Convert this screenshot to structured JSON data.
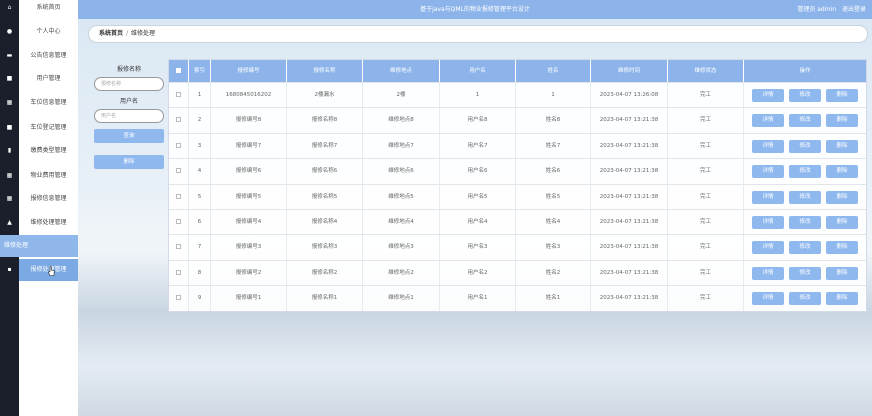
{
  "header": {
    "title": "基于java与QML的物业报修管理平台设计",
    "user_label": "管理员 admin",
    "logout_label": "退出登录"
  },
  "sidebar": {
    "items": [
      {
        "label": "系统首页",
        "icon": "home-icon"
      },
      {
        "label": "个人中心",
        "icon": "person-icon"
      },
      {
        "label": "公告信息管理",
        "icon": "contact-card-icon"
      },
      {
        "label": "用户管理",
        "icon": "monitor-icon"
      },
      {
        "label": "车位信息管理",
        "icon": "grid-icon"
      },
      {
        "label": "车位登记管理",
        "icon": "monitor-icon"
      },
      {
        "label": "缴费类型管理",
        "icon": "clipboard-icon"
      },
      {
        "label": "物业费用管理",
        "icon": "grid-icon"
      },
      {
        "label": "报修信息管理",
        "icon": "grid-icon"
      },
      {
        "label": "维修处理管理",
        "icon": "building-icon"
      }
    ],
    "sub_items": [
      {
        "label": "维修处理"
      },
      {
        "label": "报修处理管理",
        "icon": "chat-icon"
      }
    ]
  },
  "breadcrumb": {
    "home": "系统首页",
    "separator": "/",
    "current": "维修处理"
  },
  "search": {
    "name_label": "报修名称",
    "name_placeholder": "报修名称",
    "user_label": "用户名",
    "user_placeholder": "用户名",
    "query_button": "查询",
    "delete_button": "删除"
  },
  "table": {
    "headers": [
      "索引",
      "报修编号",
      "报修名称",
      "维修地点",
      "用户名",
      "姓名",
      "维修时间",
      "维修状态",
      "操作"
    ],
    "action_labels": {
      "detail": "详情",
      "edit": "修改",
      "delete": "删除"
    },
    "rows": [
      {
        "index": "1",
        "code": "1680845016202",
        "name": "2楼漏水",
        "place": "2楼",
        "user": "1",
        "realname": "1",
        "time": "2023-04-07 13:26:08",
        "status": "完工"
      },
      {
        "index": "2",
        "code": "报修编号8",
        "name": "报修名称8",
        "place": "维修地点8",
        "user": "用户名8",
        "realname": "姓名8",
        "time": "2023-04-07 13:21:38",
        "status": "完工"
      },
      {
        "index": "3",
        "code": "报修编号7",
        "name": "报修名称7",
        "place": "维修地点7",
        "user": "用户名7",
        "realname": "姓名7",
        "time": "2023-04-07 13:21:38",
        "status": "完工"
      },
      {
        "index": "4",
        "code": "报修编号6",
        "name": "报修名称6",
        "place": "维修地点6",
        "user": "用户名6",
        "realname": "姓名6",
        "time": "2023-04-07 13:21:38",
        "status": "完工"
      },
      {
        "index": "5",
        "code": "报修编号5",
        "name": "报修名称5",
        "place": "维修地点5",
        "user": "用户名5",
        "realname": "姓名5",
        "time": "2023-04-07 13:21:38",
        "status": "完工"
      },
      {
        "index": "6",
        "code": "报修编号4",
        "name": "报修名称4",
        "place": "维修地点4",
        "user": "用户名4",
        "realname": "姓名4",
        "time": "2023-04-07 13:21:38",
        "status": "完工"
      },
      {
        "index": "7",
        "code": "报修编号3",
        "name": "报修名称3",
        "place": "维修地点3",
        "user": "用户名3",
        "realname": "姓名3",
        "time": "2023-04-07 13:21:38",
        "status": "完工"
      },
      {
        "index": "8",
        "code": "报修编号2",
        "name": "报修名称2",
        "place": "维修地点2",
        "user": "用户名2",
        "realname": "姓名2",
        "time": "2023-04-07 13:21:38",
        "status": "完工"
      },
      {
        "index": "9",
        "code": "报修编号1",
        "name": "报修名称1",
        "place": "维修地点1",
        "user": "用户名1",
        "realname": "姓名1",
        "time": "2023-04-07 13:21:38",
        "status": "完工"
      }
    ]
  },
  "colors": {
    "accent": "#8cb4ea",
    "button": "#8fb8ef",
    "rail": "#1a1f2b",
    "active_item": "#7ba9e3"
  }
}
